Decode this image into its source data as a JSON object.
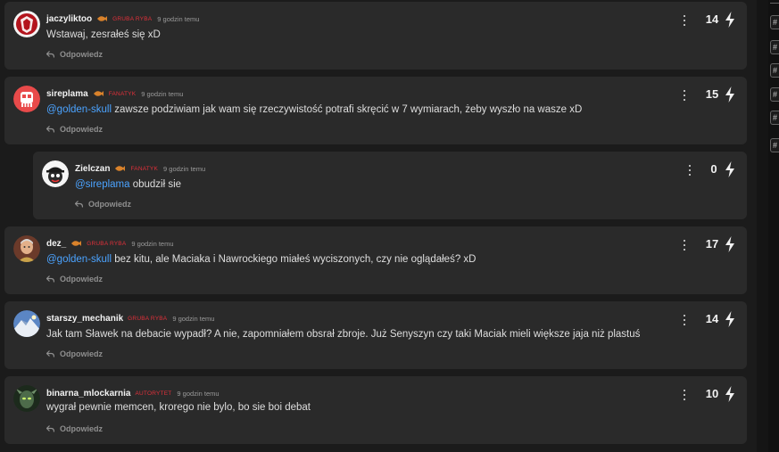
{
  "comments": [
    {
      "username": "jaczyliktoo",
      "rank": "GRUBA RYBA",
      "rank_color": "#e0303a",
      "time": "9 godzin temu",
      "mention": "",
      "text": "Wstawaj, zesrałeś się xD",
      "reply_label": "Odpowiedz",
      "score": "14",
      "avatar": "red-crest-avatar"
    },
    {
      "username": "sireplama",
      "rank": "FANATYK",
      "rank_color": "#e0303a",
      "time": "9 godzin temu",
      "mention": "@golden-skull",
      "text": " zawsze podziwiam jak wam się rzeczywistość potrafi skręcić w 7 wymiarach, żeby wyszło na wasze xD",
      "reply_label": "Odpowiedz",
      "score": "15",
      "avatar": "red-skull-avatar"
    },
    {
      "username": "Zielczan",
      "rank": "FANATYK",
      "rank_color": "#e0303a",
      "time": "9 godzin temu",
      "mention": "@sireplama",
      "text": " obudził sie",
      "reply_label": "Odpowiedz",
      "score": "0",
      "avatar": "cartoon-hat-avatar"
    },
    {
      "username": "dez_",
      "rank": "GRUBA RYBA",
      "rank_color": "#e0303a",
      "time": "9 godzin temu",
      "mention": "@golden-skull",
      "text": " bez kitu, ale Maciaka i Nawrockiego miałeś wyciszonych, czy nie oglądałeś? xD",
      "reply_label": "Odpowiedz",
      "score": "17",
      "avatar": "portrait-avatar"
    },
    {
      "username": "starszy_mechanik",
      "rank": "GRUBA RYBA",
      "rank_color": "#e0303a",
      "time": "9 godzin temu",
      "mention": "",
      "text": "Jak tam Sławek na debacie wypadł? A nie, zapomniałem obsrał zbroje. Już Senyszyn czy taki Maciak mieli większe jaja niż plastuś",
      "reply_label": "Odpowiedz",
      "score": "14",
      "avatar": "mountain-avatar"
    },
    {
      "username": "binarna_mlockarnia",
      "rank": "AUTORYTET",
      "rank_color": "#e0303a",
      "time": "9 godzin temu",
      "mention": "",
      "text": "wygrał pewnie memcen, krorego nie bylo, bo sie boi debat",
      "reply_label": "Odpowiedz",
      "score": "10",
      "avatar": "alien-avatar"
    }
  ],
  "sidebar": {
    "tag_symbol": "#"
  },
  "colors": {
    "background": "#1b1b1b",
    "card": "#2a2a2a",
    "mention": "#4ba3ff",
    "rank": "#e0303a",
    "rank_icon": "#d9822b"
  }
}
